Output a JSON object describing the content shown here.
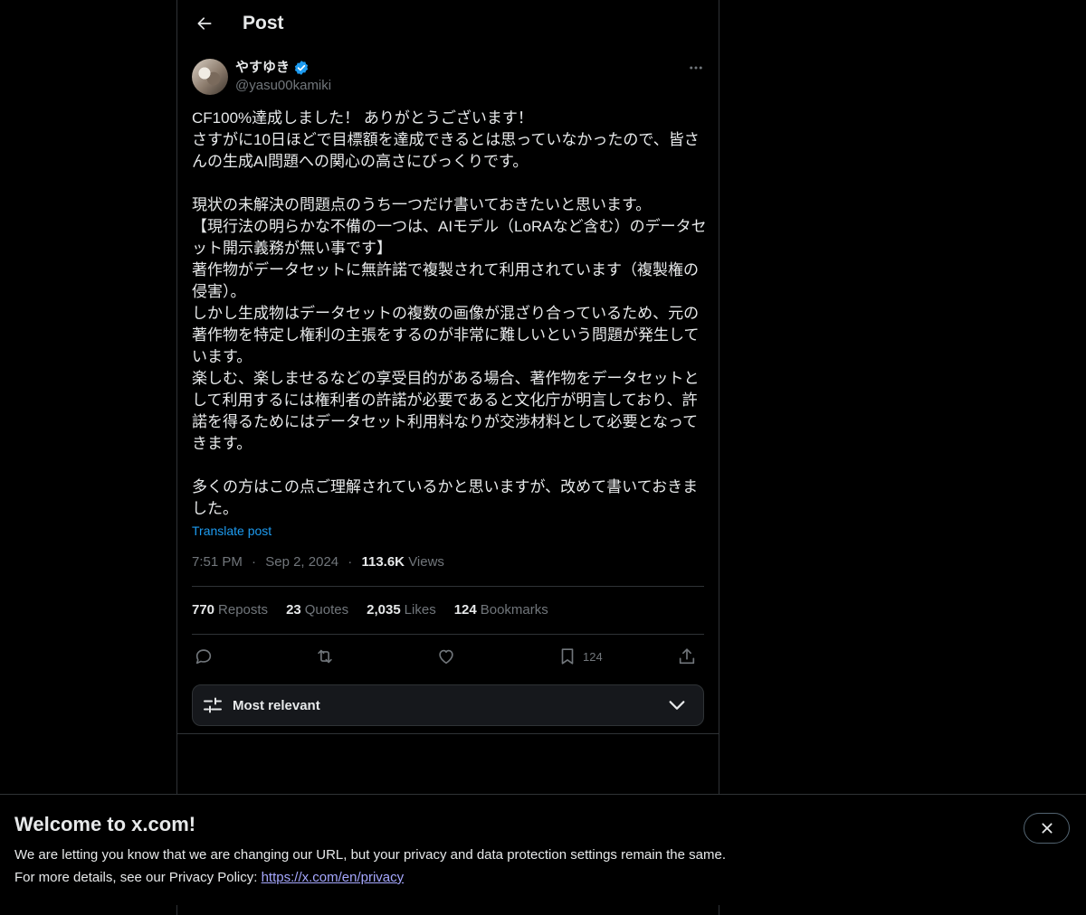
{
  "header": {
    "title": "Post"
  },
  "author": {
    "display_name": "やすゆき",
    "handle": "@yasu00kamiki",
    "verified": true
  },
  "post": {
    "text": "CF100%達成しました！ ありがとうございます！\nさすがに10日ほどで目標額を達成できるとは思っていなかったので、皆さんの生成AI問題への関心の高さにびっくりです。\n\n現状の未解決の問題点のうち一つだけ書いておきたいと思います。\n【現行法の明らかな不備の一つは、AIモデル（LoRAなど含む）のデータセット開示義務が無い事です】\n著作物がデータセットに無許諾で複製されて利用されています（複製権の侵害）。\nしかし生成物はデータセットの複数の画像が混ざり合っているため、元の著作物を特定し権利の主張をするのが非常に難しいという問題が発生しています。\n楽しむ、楽しませるなどの享受目的がある場合、著作物をデータセットとして利用するには権利者の許諾が必要であると文化庁が明言しており、許諾を得るためにはデータセット利用料なりが交渉材料として必要となってきます。\n\n多くの方はこの点ご理解されているかと思いますが、改めて書いておきました。",
    "translate_label": "Translate post",
    "time": "7:51 PM",
    "date": "Sep 2, 2024",
    "separator": "·",
    "views_count": "113.6K",
    "views_label": "Views"
  },
  "stats": [
    {
      "count": "770",
      "label": "Reposts"
    },
    {
      "count": "23",
      "label": "Quotes"
    },
    {
      "count": "2,035",
      "label": "Likes"
    },
    {
      "count": "124",
      "label": "Bookmarks"
    }
  ],
  "actions": {
    "bookmark_count": "124"
  },
  "sort": {
    "label": "Most relevant"
  },
  "banner": {
    "title": "Welcome to x.com!",
    "line1": "We are letting you know that we are changing our URL, but your privacy and data protection settings remain the same.",
    "line2_prefix": "For more details, see our Privacy Policy: ",
    "link": "https://x.com/en/privacy"
  },
  "colors": {
    "background": "#000000",
    "text": "#e7e9ea",
    "muted": "#71767b",
    "accent": "#1d9bf0",
    "border": "#2f3336",
    "link": "#a6a8ff"
  },
  "icons": [
    "back-arrow-icon",
    "verified-badge-icon",
    "more-icon",
    "reply-icon",
    "repost-icon",
    "like-icon",
    "bookmark-icon",
    "share-icon",
    "sort-sliders-icon",
    "chevron-down-icon",
    "close-icon"
  ]
}
